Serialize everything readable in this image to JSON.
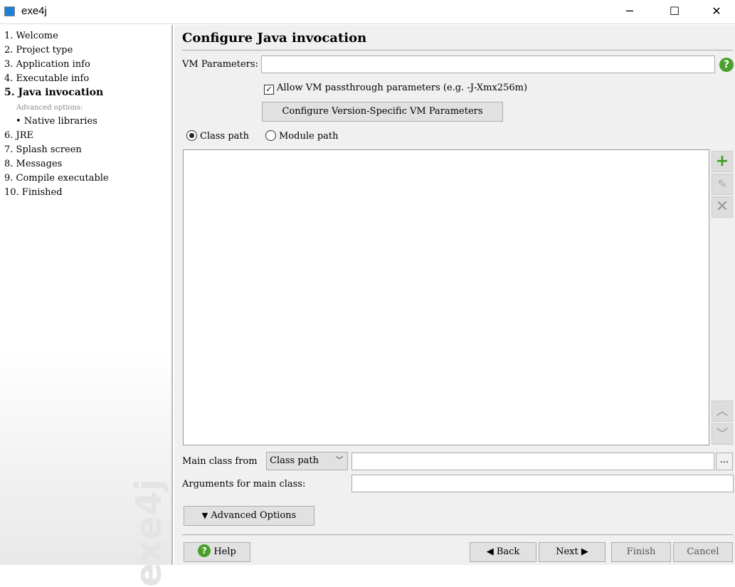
{
  "window": {
    "title": "exe4j",
    "minimize": "─",
    "maximize": "☐",
    "close": "✕"
  },
  "sidebar": {
    "steps": [
      "1. Welcome",
      "2. Project type",
      "3. Application info",
      "4. Executable info",
      "5. Java invocation"
    ],
    "advanced_label": "Advanced options:",
    "sub_items": [
      "• Native libraries"
    ],
    "steps_after": [
      "6. JRE",
      "7. Splash screen",
      "8. Messages",
      "9. Compile executable",
      "10. Finished"
    ],
    "logo": "exe4j"
  },
  "main": {
    "title": "Configure Java invocation",
    "vm_params_label": "VM Parameters:",
    "vm_params_value": "",
    "allow_passthrough": {
      "label": "Allow VM passthrough parameters (e.g. -J-Xmx256m)",
      "checked": true
    },
    "configure_version_button": "Configure Version-Specific VM Parameters",
    "path_options": [
      {
        "label": "Class path",
        "selected": true
      },
      {
        "label": "Module path",
        "selected": false
      }
    ],
    "list_items": [],
    "main_class_from_label": "Main class from",
    "main_class_from_value": "Class path",
    "main_class_value": "",
    "browse": "...",
    "arguments_label": "Arguments for main class:",
    "arguments_value": "",
    "advanced_options_button": "Advanced Options"
  },
  "footer": {
    "help": "Help",
    "back": "Back",
    "next": "Next",
    "finish": "Finish",
    "cancel": "Cancel"
  }
}
